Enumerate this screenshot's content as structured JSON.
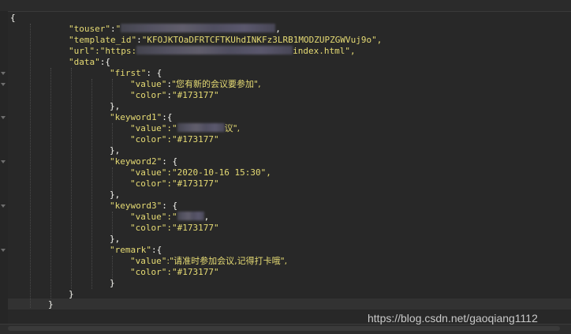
{
  "editor": {
    "lines": {
      "open": "{",
      "touser_key": "\"touser\"",
      "touser_tail": ",",
      "template_key": "\"template_id\"",
      "template_visible": "KFOJKTOaDFRTCFTKUhdINKFz3LRB1MODZUPZGWVuj9o\",",
      "url_key": "\"url\"",
      "url_prefix": ":\"https:",
      "url_suffix": "index.html\",",
      "data_key": "\"data\"",
      "data_open": ":{",
      "first_key": "\"first\"",
      "first_open": ": {",
      "first_value_key": "\"value\"",
      "first_value": "\"您有新的会议要参加\",",
      "first_color_key": "\"color\"",
      "first_color": "\"#173177\"",
      "close_comma_1": "},",
      "kw1_key": "\"keyword1\"",
      "kw1_open": ":{",
      "kw1_value_key": "\"value\"",
      "kw1_value_pre": ":\"",
      "kw1_value_post": "议\",",
      "kw1_color_key": "\"color\"",
      "kw1_color": ":\"#173177\"",
      "close_comma_2": "},",
      "kw2_key": "\"keyword2\"",
      "kw2_open": ": {",
      "kw2_value_key": "\"value\"",
      "kw2_value": ":\"2020-10-16 15:30\",",
      "kw2_color_key": "\"color\"",
      "kw2_color": ":\"#173177\"",
      "close_comma_3": "},",
      "kw3_key": "\"keyword3\"",
      "kw3_open": ": {",
      "kw3_value_key": "\"value\"",
      "kw3_value_pre": ":\"",
      "kw3_value_post": ",",
      "kw3_color_key": "\"color\"",
      "kw3_color": ":\"#173177\"",
      "close_comma_4": "},",
      "remark_key": "\"remark\"",
      "remark_open": ":{",
      "remark_value_key": "\"value\"",
      "remark_value": ":\"请准时参加会议,记得打卡哦\",",
      "remark_color_key": "\"color\"",
      "remark_color": ":\"#173177\"",
      "close_data_inner": "}",
      "close_data": "}",
      "close_root": "}"
    }
  },
  "watermark": "https://blog.csdn.net/gaoqiang1112",
  "theme": {
    "background": "#282828",
    "string_color": "#e6db74",
    "text_color": "#f8f8f2"
  }
}
